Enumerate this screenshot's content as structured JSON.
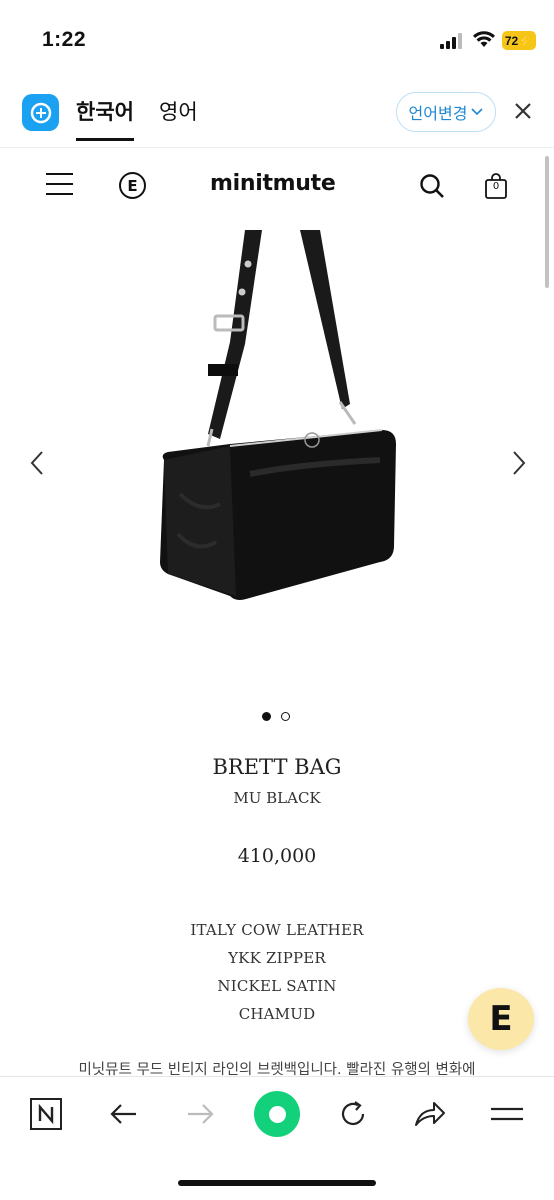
{
  "status_bar": {
    "time": "1:22",
    "battery": "72"
  },
  "translate_bar": {
    "active_lang": "한국어",
    "other_lang": "영어",
    "change_label": "언어변경"
  },
  "site": {
    "brand": "minitmute",
    "brand_icon_letter": "E",
    "cart_count": "0"
  },
  "gallery": {
    "slide_count": 2,
    "active_slide": 1
  },
  "product": {
    "name": "BRETT BAG",
    "variant": "MU BLACK",
    "price": "410,000",
    "specs": [
      "ITALY COW LEATHER",
      "YKK ZIPPER",
      "NICKEL SATIN",
      "CHAMUD"
    ],
    "description": "미닛뮤트 무드 빈티지 라인의 브렛백입니다. 빨라진 유행의 변화에"
  },
  "floating_button": {
    "letter": "E"
  },
  "icons": {
    "translate_logo": "translate-app-icon",
    "close": "close-icon",
    "menu": "hamburger-icon",
    "search": "search-icon",
    "cart": "shopping-bag-icon",
    "prev": "chevron-left-icon",
    "next": "chevron-right-icon",
    "n_app": "n-app-icon",
    "back": "back-arrow-icon",
    "forward": "forward-arrow-icon",
    "home": "home-icon",
    "reload": "reload-icon",
    "share": "share-icon",
    "toolbar_menu": "menu-icon"
  },
  "colors": {
    "accent_blue": "#1aa1f2",
    "home_green": "#13d17a",
    "float_yellow": "#fbe7a8"
  }
}
